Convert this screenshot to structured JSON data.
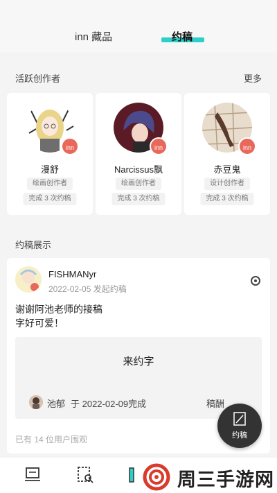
{
  "top_tabs": [
    {
      "label": "inn 藏品"
    },
    {
      "label": "约稿"
    }
  ],
  "colors": {
    "accent": "#2ecfc9",
    "badge": "#e8685b",
    "fab": "#333333"
  },
  "creators_section": {
    "title": "活跃创作者",
    "more": "更多"
  },
  "creators": [
    {
      "name": "漫舒",
      "badge": "inn",
      "role": "绘画创作者",
      "stat": "完成 3 次约稿"
    },
    {
      "name": "Narcissus飘",
      "badge": "inn",
      "role": "绘画创作者",
      "stat": "完成 3 次约稿"
    },
    {
      "name": "赤豆鬼",
      "badge": "inn",
      "role": "设计创作者",
      "stat": "完成 3 次约稿"
    }
  ],
  "showcase_section": {
    "title": "约稿展示"
  },
  "post": {
    "user": "FISHMANyr",
    "date": "2022-02-05 发起约稿",
    "text": "谢谢阿池老师的接稿\n字好可爱！",
    "quote_title": "来约字",
    "author": "池郁",
    "finished": "于 2022-02-09完成",
    "fee": "稿酬",
    "watchers": "已有 14 位用户围观"
  },
  "fab": {
    "label": "约稿",
    "icon": "edit-icon"
  },
  "bottom_nav": [
    {
      "icon": "home-icon"
    },
    {
      "icon": "search-doc-icon"
    },
    {
      "icon": "pencil-icon"
    }
  ],
  "watermark": {
    "text": "周三手游网"
  }
}
